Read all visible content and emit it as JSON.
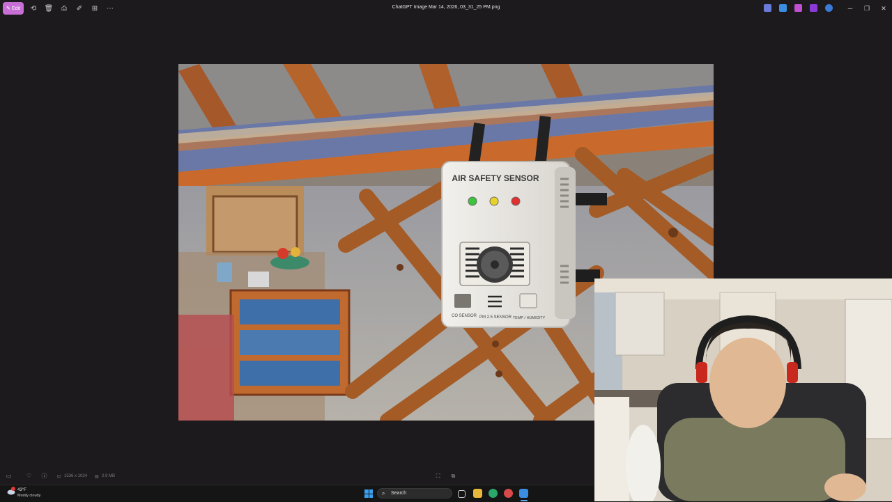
{
  "window": {
    "title": "ChatGPT Image Mar 14, 2026, 03_31_25 PM.png",
    "edit_label": "Edit"
  },
  "toolbar": {
    "icons": [
      "edit-icon",
      "rotate-icon",
      "delete-icon",
      "print-icon",
      "edit-image-icon",
      "crop-icon",
      "more-icon"
    ]
  },
  "photo": {
    "device_title": "AIR SAFETY SENSOR",
    "indicator_colors": [
      "#3cc43a",
      "#e8d22a",
      "#e03030"
    ],
    "sensor_labels": [
      "CO SENSOR",
      "PM 2.5 SENSOR",
      "TEMP / HUMIDITY"
    ]
  },
  "infobar": {
    "dimensions": "1536 x 1024",
    "filesize": "2.9 MB"
  },
  "taskbar": {
    "weather_temp": "43°F",
    "weather_desc": "Mostly cloudy",
    "search_placeholder": "Search"
  },
  "colors": {
    "accent": "#c86fd6",
    "background": "#1c1a1c"
  }
}
